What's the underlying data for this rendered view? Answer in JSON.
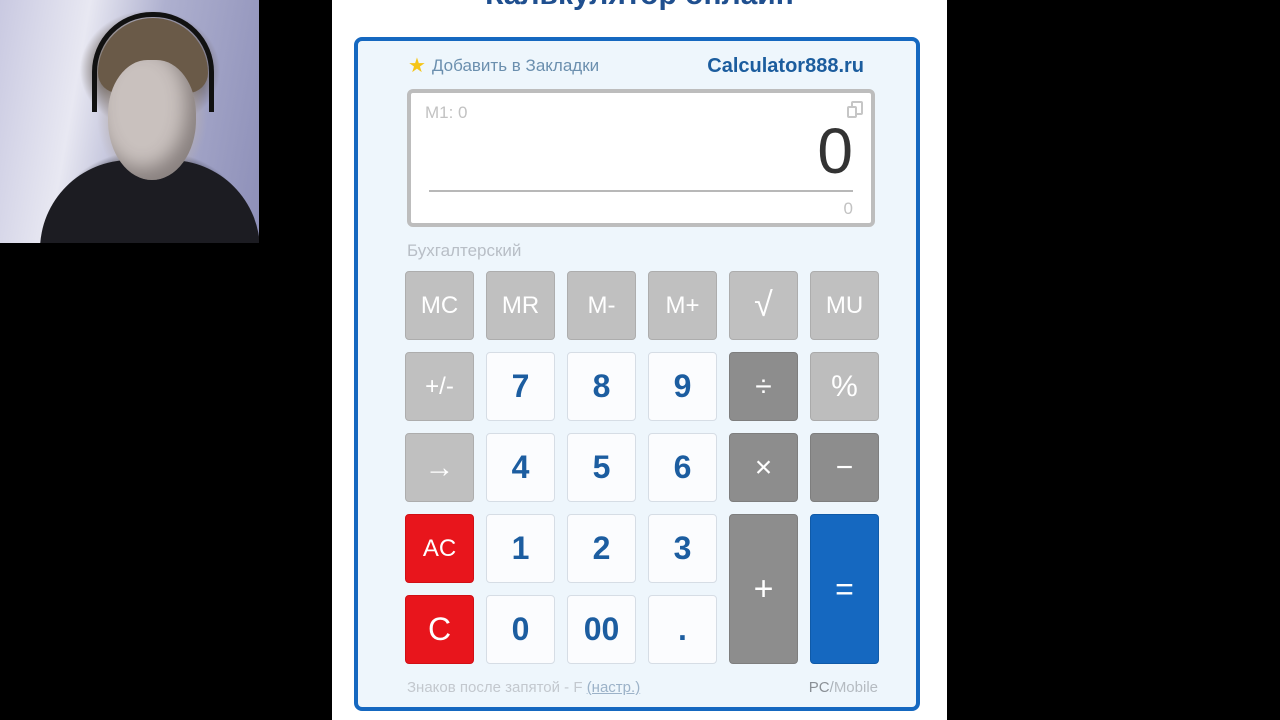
{
  "page": {
    "title": "Калькулятор онлайн"
  },
  "calculator": {
    "bookmark_label": "Добавить в Закладки",
    "brand": "Calculator888.ru",
    "memory_label": "M1: 0",
    "display_value": "0",
    "display_subvalue": "0",
    "mode_label": "Бухгалтерский",
    "buttons": {
      "mc": "MC",
      "mr": "MR",
      "mminus": "M-",
      "mplus": "M+",
      "sqrt": "√",
      "mu": "MU",
      "plusminus": "+/-",
      "n7": "7",
      "n8": "8",
      "n9": "9",
      "divide": "÷",
      "percent": "%",
      "backspace": "→",
      "n4": "4",
      "n5": "5",
      "n6": "6",
      "multiply": "×",
      "minus": "−",
      "ac": "AC",
      "n1": "1",
      "n2": "2",
      "n3": "3",
      "plus": "+",
      "equals": "=",
      "c": "C",
      "n0": "0",
      "n00": "00",
      "dot": "."
    },
    "footer": {
      "decimals_label": "Знаков после запятой - F",
      "settings_link": "(настр.)",
      "pc_label": "PC",
      "separator": "/",
      "mobile_label": "Mobile"
    }
  },
  "colors": {
    "accent_blue": "#1568c0",
    "clear_red": "#e8151c",
    "digit_text": "#1c5da0"
  },
  "icons": {
    "bookmark": "star-icon",
    "copy": "copy-icon"
  }
}
